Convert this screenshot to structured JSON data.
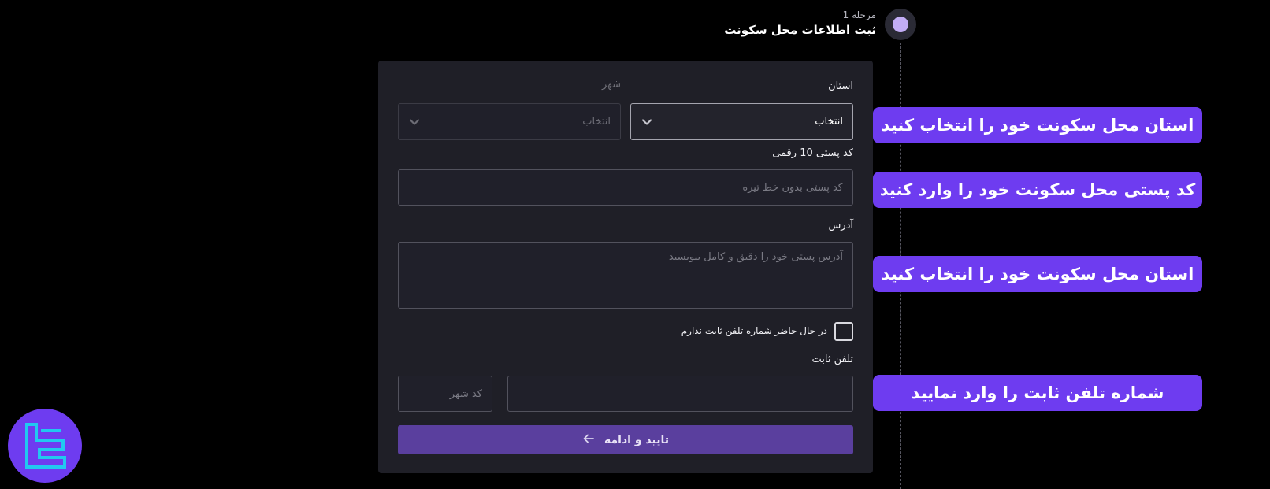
{
  "step": {
    "label": "مرحله 1",
    "title": "ثبت اطلاعات محل سکونت"
  },
  "form": {
    "province_label": "استان",
    "province_value": "انتخاب",
    "city_label": "شهر",
    "city_value": "انتخاب",
    "postal_label": "کد پستی 10 رقمی",
    "postal_placeholder": "کد پستی بدون خط تیره",
    "address_label": "آدرس",
    "address_placeholder": "آدرس پستی خود را دقیق و کامل بنویسید",
    "no_phone_label": "در حال حاضر شماره تلفن ثابت ندارم",
    "phone_label": "تلفن ثابت",
    "area_code_placeholder": "کد شهر",
    "submit_label": "تایید و ادامه"
  },
  "callouts": [
    "استان محل سکونت خود را انتخاب کنید",
    "کد پستی محل سکونت خود را وارد کنید",
    "استان محل سکونت خود را انتخاب کنید",
    "شماره تلفن ثابت را وارد نمایید"
  ],
  "colors": {
    "background": "#000000",
    "card": "#1f1f27",
    "accent": "#6e3cf0",
    "submit": "#5a3f9e",
    "step_dot": "#c2adf5"
  }
}
